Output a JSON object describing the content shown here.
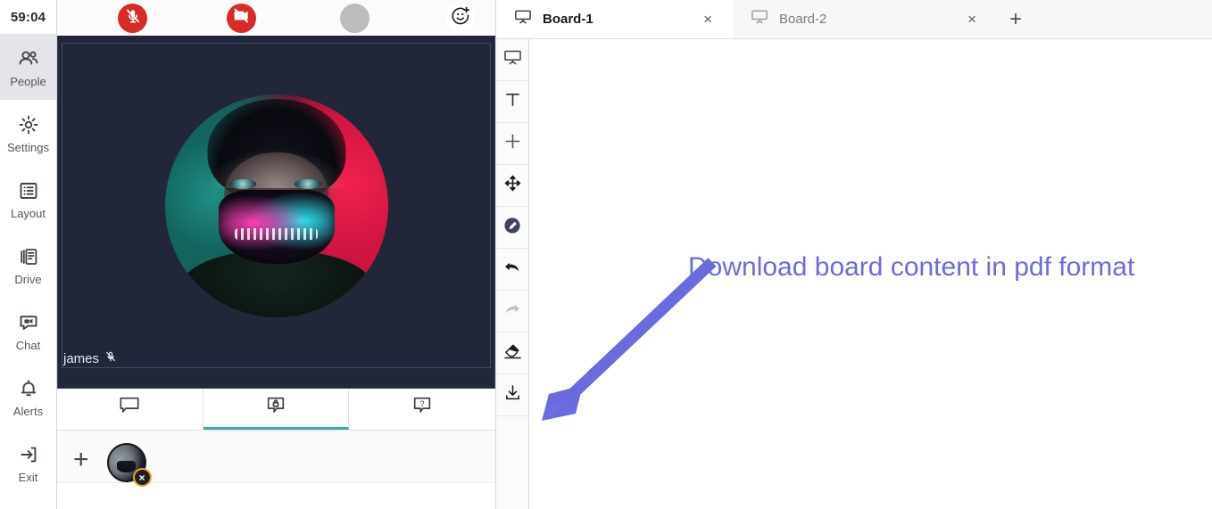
{
  "nav": {
    "timer": "59:04",
    "items": [
      {
        "label": "People",
        "icon": "people-icon",
        "active": true
      },
      {
        "label": "Settings",
        "icon": "gear-icon",
        "active": false
      },
      {
        "label": "Layout",
        "icon": "layout-icon",
        "active": false
      },
      {
        "label": "Drive",
        "icon": "drive-icon",
        "active": false
      },
      {
        "label": "Chat",
        "icon": "chat-icon",
        "active": false
      },
      {
        "label": "Alerts",
        "icon": "bell-icon",
        "active": false
      },
      {
        "label": "Exit",
        "icon": "exit-icon",
        "active": false
      }
    ]
  },
  "meeting": {
    "controls": [
      {
        "name": "mute-microphone-button",
        "icon": "microphone-muted-icon",
        "style": "red"
      },
      {
        "name": "stop-video-button",
        "icon": "camera-off-icon",
        "style": "red"
      },
      {
        "name": "record-button",
        "icon": "record-dot-icon",
        "style": "gray"
      },
      {
        "name": "reaction-button",
        "icon": "smiley-plus-icon",
        "style": "white"
      }
    ],
    "participant": {
      "name": "james",
      "muted_icon": "microphone-muted-icon"
    },
    "tabs": [
      {
        "name": "tab-chat",
        "icon": "speech-bubble-icon",
        "active": false
      },
      {
        "name": "tab-private",
        "icon": "speech-bubble-lock-icon",
        "active": true
      },
      {
        "name": "tab-help",
        "icon": "speech-bubble-question-icon",
        "active": false
      }
    ],
    "roster": {
      "add_label": "+",
      "remove_badge": "×"
    }
  },
  "board": {
    "tabs": [
      {
        "label": "Board-1",
        "icon": "whiteboard-icon",
        "active": true,
        "close": "×"
      },
      {
        "label": "Board-2",
        "icon": "whiteboard-icon",
        "active": false,
        "close": "×"
      }
    ],
    "new_tab_label": "+",
    "tools": [
      {
        "name": "tool-board",
        "icon": "whiteboard-icon",
        "enabled": true
      },
      {
        "name": "tool-text",
        "icon": "text-t-icon",
        "enabled": true
      },
      {
        "name": "tool-add",
        "icon": "plus-icon",
        "enabled": true
      },
      {
        "name": "tool-move",
        "icon": "move-arrows-icon",
        "enabled": true
      },
      {
        "name": "tool-pen",
        "icon": "pen-circle-icon",
        "enabled": true
      },
      {
        "name": "tool-undo",
        "icon": "undo-arrow-icon",
        "enabled": true
      },
      {
        "name": "tool-redo",
        "icon": "redo-arrow-icon",
        "enabled": false
      },
      {
        "name": "tool-eraser",
        "icon": "eraser-icon",
        "enabled": true
      },
      {
        "name": "tool-download",
        "icon": "download-icon",
        "enabled": true
      }
    ]
  },
  "annotation": {
    "text": "Download board content in pdf format",
    "color": "#6b6be0"
  },
  "colors": {
    "accent_teal": "#3fa8ad",
    "danger_red": "#d82b27",
    "stage_navy": "#212639",
    "annotation_blue": "#6b6be0",
    "nav_active_bg": "#e3e5ea"
  }
}
